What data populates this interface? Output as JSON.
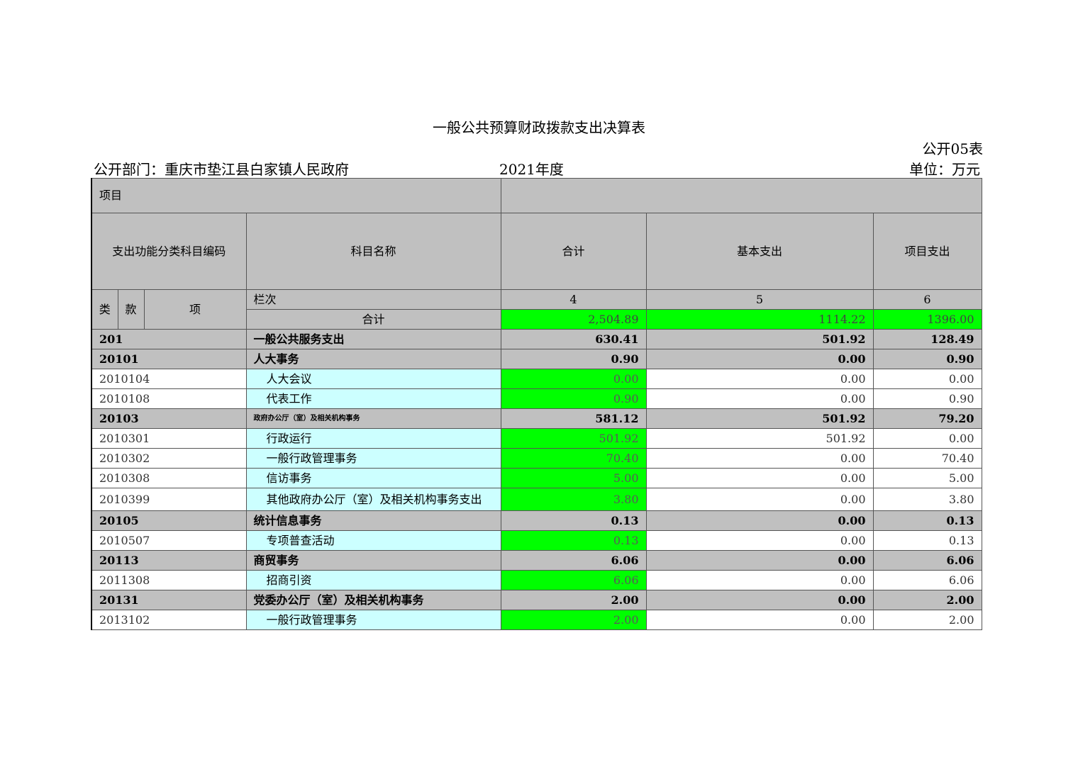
{
  "header": {
    "title": "一般公共预算财政拨款支出决算表",
    "form_no": "公开05表",
    "department": "公开部门：重庆市垫江县白家镇人民政府",
    "year": "2021年度",
    "unit": "单位：万元"
  },
  "columns": {
    "project": "项目",
    "code": "支出功能分类科目编码",
    "name": "科目名称",
    "total": "合计",
    "basic": "基本支出",
    "item": "项目支出",
    "lei": "类",
    "kuan": "款",
    "xiang": "项",
    "lanci": "栏次",
    "col4": "4",
    "col5": "5",
    "col6": "6"
  },
  "total_row": {
    "label": "合计",
    "total": "2,504.89",
    "basic": "1114.22",
    "item": "1396.00"
  },
  "rows": [
    {
      "code": "201",
      "name": "一般公共服务支出",
      "total": "630.41",
      "basic": "501.92",
      "item": "128.49"
    },
    {
      "code": "20101",
      "name": "人大事务",
      "total": "0.90",
      "basic": "0.00",
      "item": "0.90"
    },
    {
      "code": "2010104",
      "name": "人大会议",
      "total": "0.00",
      "basic": "0.00",
      "item": "0.00"
    },
    {
      "code": "2010108",
      "name": "代表工作",
      "total": "0.90",
      "basic": "0.00",
      "item": "0.90"
    },
    {
      "code": "20103",
      "name": "政府办公厅（室）及相关机构事务",
      "total": "581.12",
      "basic": "501.92",
      "item": "79.20"
    },
    {
      "code": "2010301",
      "name": "行政运行",
      "total": "501.92",
      "basic": "501.92",
      "item": "0.00"
    },
    {
      "code": "2010302",
      "name": "一般行政管理事务",
      "total": "70.40",
      "basic": "0.00",
      "item": "70.40"
    },
    {
      "code": "2010308",
      "name": "信访事务",
      "total": "5.00",
      "basic": "0.00",
      "item": "5.00"
    },
    {
      "code": "2010399",
      "name": "其他政府办公厅（室）及相关机构事务支出",
      "total": "3.80",
      "basic": "0.00",
      "item": "3.80"
    },
    {
      "code": "20105",
      "name": "统计信息事务",
      "total": "0.13",
      "basic": "0.00",
      "item": "0.13"
    },
    {
      "code": "2010507",
      "name": "专项普查活动",
      "total": "0.13",
      "basic": "0.00",
      "item": "0.13"
    },
    {
      "code": "20113",
      "name": "商贸事务",
      "total": "6.06",
      "basic": "0.00",
      "item": "6.06"
    },
    {
      "code": "2011308",
      "name": "招商引资",
      "total": "6.06",
      "basic": "0.00",
      "item": "6.06"
    },
    {
      "code": "20131",
      "name": "党委办公厅（室）及相关机构事务",
      "total": "2.00",
      "basic": "0.00",
      "item": "2.00"
    },
    {
      "code": "2013102",
      "name": "一般行政管理事务",
      "total": "2.00",
      "basic": "0.00",
      "item": "2.00"
    }
  ]
}
